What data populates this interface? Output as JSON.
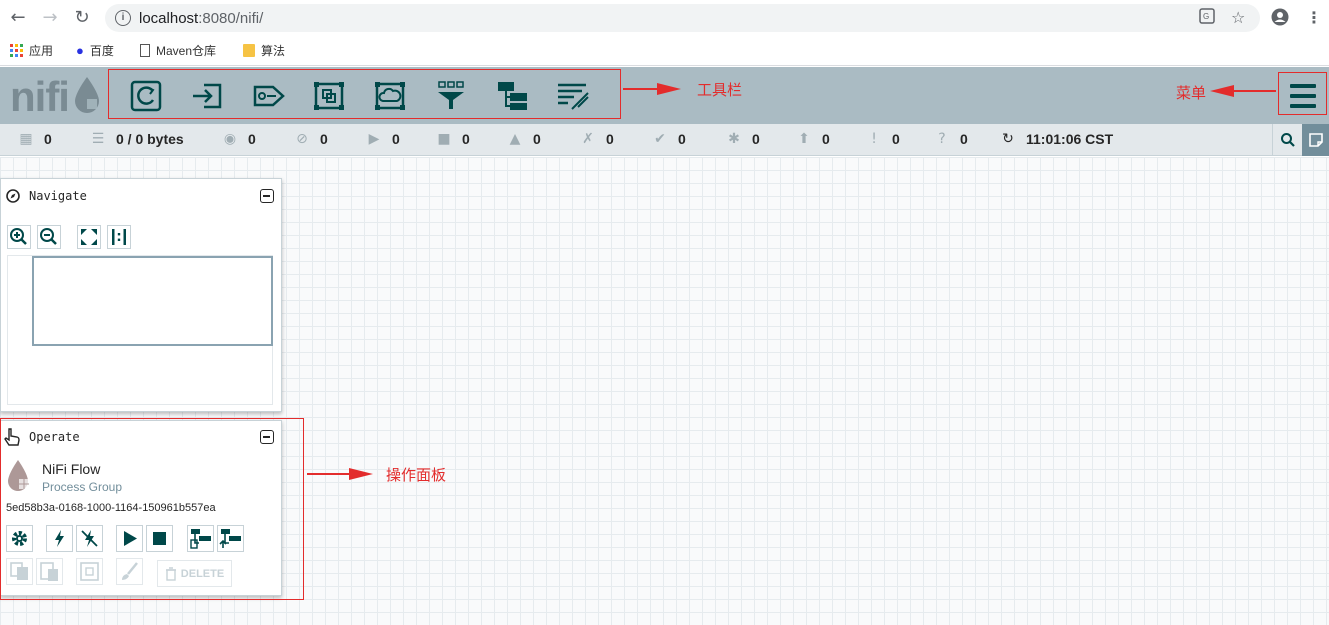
{
  "browser": {
    "url_host": "localhost",
    "url_rest": ":8080/nifi/",
    "bookmarks": [
      {
        "label": "应用",
        "icon": "apps-grid-icon"
      },
      {
        "label": "百度",
        "icon": "baidu-paw-icon"
      },
      {
        "label": "Maven仓库",
        "icon": "page-icon"
      },
      {
        "label": "算法",
        "icon": "folder-icon"
      }
    ]
  },
  "header": {
    "logo_text": "nifi",
    "toolbar_annotation": "工具栏",
    "menu_annotation": "菜单",
    "toolbar_icons": [
      "processor-icon",
      "input-port-icon",
      "output-port-icon",
      "process-group-icon",
      "remote-process-group-icon",
      "funnel-icon",
      "template-icon",
      "label-icon"
    ]
  },
  "status": {
    "active_threads": "0",
    "queued": "0 / 0 bytes",
    "transmitting": "0",
    "not_transmitting": "0",
    "running": "0",
    "stopped": "0",
    "invalid": "0",
    "disabled": "0",
    "up_to_date": "0",
    "locally_modified": "0",
    "stale": "0",
    "locally_modified_stale": "0",
    "sync_failure": "0",
    "refresh_time": "11:01:06 CST"
  },
  "navigate": {
    "title": "Navigate"
  },
  "operate": {
    "title": "Operate",
    "component_name": "NiFi Flow",
    "component_type": "Process Group",
    "component_id": "5ed58b3a-0168-1000-1164-150961b557ea",
    "delete_label": "DELETE",
    "annotation": "操作面板"
  },
  "colors": {
    "header_bg": "#aabbc3",
    "icon_dark": "#004849",
    "annotation_red": "#e32c2c"
  }
}
